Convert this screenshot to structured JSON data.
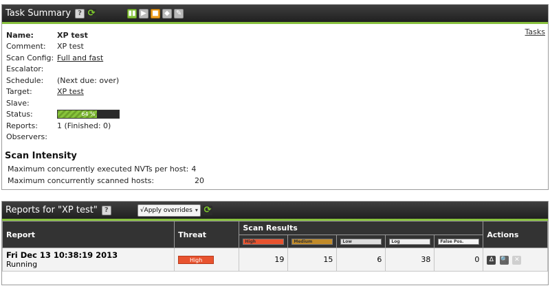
{
  "summary": {
    "title": "Task Summary",
    "tasks_link": "Tasks",
    "fields": {
      "name_label": "Name:",
      "name_value": "XP test",
      "comment_label": "Comment:",
      "comment_value": "XP test",
      "scan_config_label": "Scan Config:",
      "scan_config_value": "Full and fast",
      "escalator_label": "Escalator:",
      "schedule_label": "Schedule:",
      "schedule_value": "(Next due: over)",
      "target_label": "Target:",
      "target_value": "XP test",
      "slave_label": "Slave:",
      "status_label": "Status:",
      "status_progress_text": "64 %",
      "status_progress": 0.64,
      "reports_label": "Reports:",
      "reports_value": "1 (Finished: 0)",
      "observers_label": "Observers:"
    },
    "intensity": {
      "title": "Scan Intensity",
      "nvts_label": "Maximum concurrently executed NVTs per host:",
      "nvts_value": "4",
      "hosts_label": "Maximum concurrently scanned hosts:",
      "hosts_value": "20"
    },
    "toolbar_icons": [
      "start-icon",
      "resume-icon",
      "stop-icon",
      "disabled-icon",
      "wrench-icon"
    ]
  },
  "reports": {
    "title": "Reports for \"XP test\"",
    "overrides_select": "√Apply overrides",
    "headers": {
      "report": "Report",
      "threat": "Threat",
      "scan_results": "Scan Results",
      "actions": "Actions"
    },
    "severity_headers": [
      "High",
      "Medium",
      "Low",
      "Log",
      "False Pos."
    ],
    "severity_colors": [
      "#e8532f",
      "#c18b2a",
      "#dddddd",
      "#eeeeee",
      "#f5f5f5"
    ],
    "row": {
      "date": "Fri Dec 13 10:38:19 2013",
      "status": "Running",
      "threat": "High",
      "high": "19",
      "medium": "15",
      "low": "6",
      "log": "38",
      "false_pos": "0"
    }
  }
}
